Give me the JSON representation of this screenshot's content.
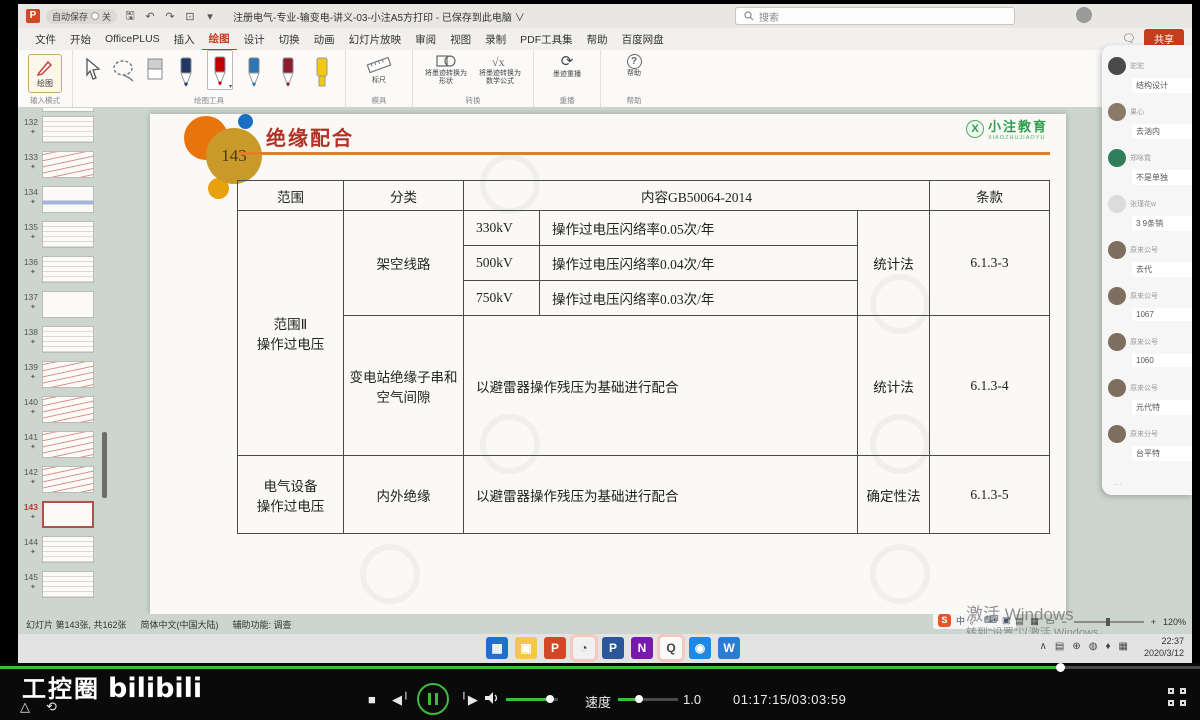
{
  "titlebar": {
    "autosave_label": "自动保存",
    "autosave_state": "关",
    "filename": "注册电气-专业-输变电-讲义-03-小注A5方打印 - 已保存到此电脑 ∨",
    "search_placeholder": "搜索"
  },
  "menubar": {
    "items": [
      "文件",
      "开始",
      "OfficePLUS",
      "插入",
      "绘图",
      "设计",
      "切换",
      "动画",
      "幻灯片放映",
      "审阅",
      "视图",
      "录制",
      "PDF工具集",
      "帮助",
      "百度网盘"
    ],
    "active_index": 4,
    "share_label": "共享"
  },
  "ribbon": {
    "draw_button_label": "绘图",
    "group_input": "输入模式",
    "group_tools": "绘图工具",
    "ruler_label": "标尺",
    "group_stencils": "模具",
    "convert_shape_label": "将墨迹转换为形状",
    "convert_math_label": "将墨迹转换为数学公式",
    "group_convert": "转换",
    "replay_label": "墨迹重播",
    "group_replay": "重播",
    "help_label": "帮助",
    "group_help": "帮助",
    "pens": [
      {
        "name": "navy-pen",
        "color": "#1f3864",
        "selected": false,
        "highlighter": false
      },
      {
        "name": "red-pen",
        "color": "#c00000",
        "selected": true,
        "highlighter": false
      },
      {
        "name": "blue-pen",
        "color": "#2e75b6",
        "selected": false,
        "highlighter": false
      },
      {
        "name": "maroon-pen",
        "color": "#8c1f2f",
        "selected": false,
        "highlighter": false
      },
      {
        "name": "yellow-highlighter",
        "color": "#f2c811",
        "selected": false,
        "highlighter": true
      }
    ]
  },
  "sidebar": {
    "slides": [
      {
        "n": "132",
        "style": "lines"
      },
      {
        "n": "133",
        "style": "red"
      },
      {
        "n": "134",
        "style": "blue"
      },
      {
        "n": "135",
        "style": "lines"
      },
      {
        "n": "136",
        "style": "lines"
      },
      {
        "n": "137",
        "style": "plain"
      },
      {
        "n": "138",
        "style": "lines"
      },
      {
        "n": "139",
        "style": "red"
      },
      {
        "n": "140",
        "style": "red"
      },
      {
        "n": "141",
        "style": "red"
      },
      {
        "n": "142",
        "style": "red"
      },
      {
        "n": "143",
        "style": "sel"
      },
      {
        "n": "144",
        "style": "lines"
      },
      {
        "n": "145",
        "style": "lines"
      }
    ],
    "selected": "143"
  },
  "slide": {
    "number": "143",
    "title": "绝缘配合",
    "logo_x": "X",
    "logo_title": "小注教育",
    "logo_sub": "XIAOZHUJIAOYU",
    "table": {
      "h_scope": "范围",
      "h_class": "分类",
      "h_content": "内容GB50064-2014",
      "h_clause": "条款",
      "scope1": "范围Ⅱ\n操作过电压",
      "class1": "架空线路",
      "v1": "330kV",
      "d1": "操作过电压闪络率0.05次/年",
      "v2": "500kV",
      "d2": "操作过电压闪络率0.04次/年",
      "v3": "750kV",
      "d3": "操作过电压闪络率0.03次/年",
      "m1": "统计法",
      "c1": "6.1.3-3",
      "class2": "变电站绝缘子串和\n空气间隙",
      "d4": "以避雷器操作残压为基础进行配合",
      "m2": "统计法",
      "c2": "6.1.3-4",
      "scope2": "电气设备\n操作过电压",
      "class3": "内外绝缘",
      "d5": "以避雷器操作残压为基础进行配合",
      "m3": "确定性法",
      "c3": "6.1.3-5"
    }
  },
  "chat": {
    "items": [
      {
        "name": "驼驼",
        "msg": "结构设计",
        "color": "#4a4a4a"
      },
      {
        "name": "果心",
        "msg": "去汹内",
        "color": "#8a7a68"
      },
      {
        "name": "郑咏霓",
        "msg": "不是单独",
        "color": "#2f7d5a"
      },
      {
        "name": "张瑾花w",
        "msg": "3 9条销",
        "color": "#dcdcdc"
      },
      {
        "name": "原来公号",
        "msg": "去代",
        "color": "#7d6e5d"
      },
      {
        "name": "原来公号",
        "msg": "1067",
        "color": "#7d6e5d"
      },
      {
        "name": "原来公号",
        "msg": "1060",
        "color": "#7d6e5d"
      },
      {
        "name": "原来公号",
        "msg": "元代特",
        "color": "#7d6e5d"
      },
      {
        "name": "原来分号",
        "msg": "台平特",
        "color": "#7d6e5d"
      }
    ]
  },
  "statusbar": {
    "slide_info": "幻灯片 第143张, 共162张",
    "language": "简体中文(中国大陆)",
    "accessibility": "辅助功能: 调查",
    "zoom_level": "120%"
  },
  "watermark": {
    "line1": "激活 Windows",
    "line2": "转到\"设置\"以激活 Windows。"
  },
  "taskbar": {
    "time": "22:37",
    "date": "2020/3/12",
    "apps": [
      {
        "bg": "#1f6fd0",
        "ch": "▦",
        "hl": false
      },
      {
        "bg": "#f5c64a",
        "ch": "▣",
        "hl": false
      },
      {
        "bg": "#d24726",
        "ch": "P",
        "hl": false
      },
      {
        "bg": "#f0f0f0",
        "ch": "◔",
        "hl": true
      },
      {
        "bg": "#2b579a",
        "ch": "P",
        "hl": false
      },
      {
        "bg": "#7719aa",
        "ch": "N",
        "hl": false
      },
      {
        "bg": "#fafafa",
        "ch": "Q",
        "hl": true
      },
      {
        "bg": "#1e88e5",
        "ch": "◉",
        "hl": false
      },
      {
        "bg": "#2b7cd3",
        "ch": "W",
        "hl": false
      }
    ],
    "tray_glyphs": [
      "∧",
      "▤",
      "⊕",
      "◍",
      "♦",
      "▦"
    ]
  },
  "player": {
    "brand": "工控圈",
    "logo": "bilibili",
    "speed_label": "速度",
    "speed_value": "1.0",
    "time_display": "01:17:15/03:03:59",
    "progress_percent": 88
  },
  "accent_colors": {
    "ppt_red": "#c43e1c",
    "bili_green": "#3dbb3d",
    "slide_title_red": "#b33226",
    "slide_rule_orange": "#e07f26",
    "logo_green": "#2e9e4f"
  }
}
